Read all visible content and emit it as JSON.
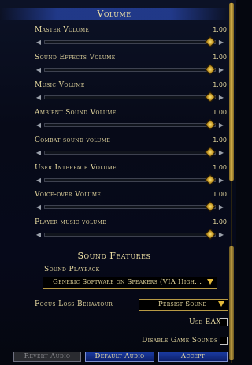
{
  "volume_section": {
    "title": "Volume"
  },
  "sliders": [
    {
      "label": "Master Volume",
      "value": "1.00",
      "level": 1.0
    },
    {
      "label": "Sound Effects Volume",
      "value": "1.00",
      "level": 1.0
    },
    {
      "label": "Music Volume",
      "value": "1.00",
      "level": 1.0
    },
    {
      "label": "Ambient Sound Volume",
      "value": "1.00",
      "level": 1.0
    },
    {
      "label": "Combat sound volume",
      "value": "1.00",
      "level": 1.0
    },
    {
      "label": "User Interface Volume",
      "value": "1.00",
      "level": 1.0
    },
    {
      "label": "Voice-over Volume",
      "value": "1.00",
      "level": 1.0
    },
    {
      "label": "Player music volume",
      "value": "1.00",
      "level": 1.0
    }
  ],
  "features_section": {
    "title": "Sound Features",
    "sound_playback_label": "Sound Playback",
    "sound_playback_value": "Generic Software on Speakers (VIA High...",
    "focus_loss_label": "Focus Loss Behaviour",
    "focus_loss_value": "Persist Sound",
    "use_eax_label": "Use EAX",
    "use_eax_checked": false,
    "disable_game_sounds_label": "Disable Game Sounds",
    "disable_game_sounds_checked": false
  },
  "buttons": {
    "revert": "Revert Audio",
    "default": "Default Audio",
    "accept": "Accept"
  },
  "colors": {
    "text_gold": "#e6d9a0",
    "knob_gold": "#e3b93a",
    "header_blue": "#2846aa",
    "background": "#05070f"
  },
  "icons": {
    "slider_left": "arrow-left-icon",
    "slider_right": "arrow-right-icon",
    "slider_knob": "diamond-knob-icon",
    "dropdown_caret": "triangle-down-icon"
  }
}
